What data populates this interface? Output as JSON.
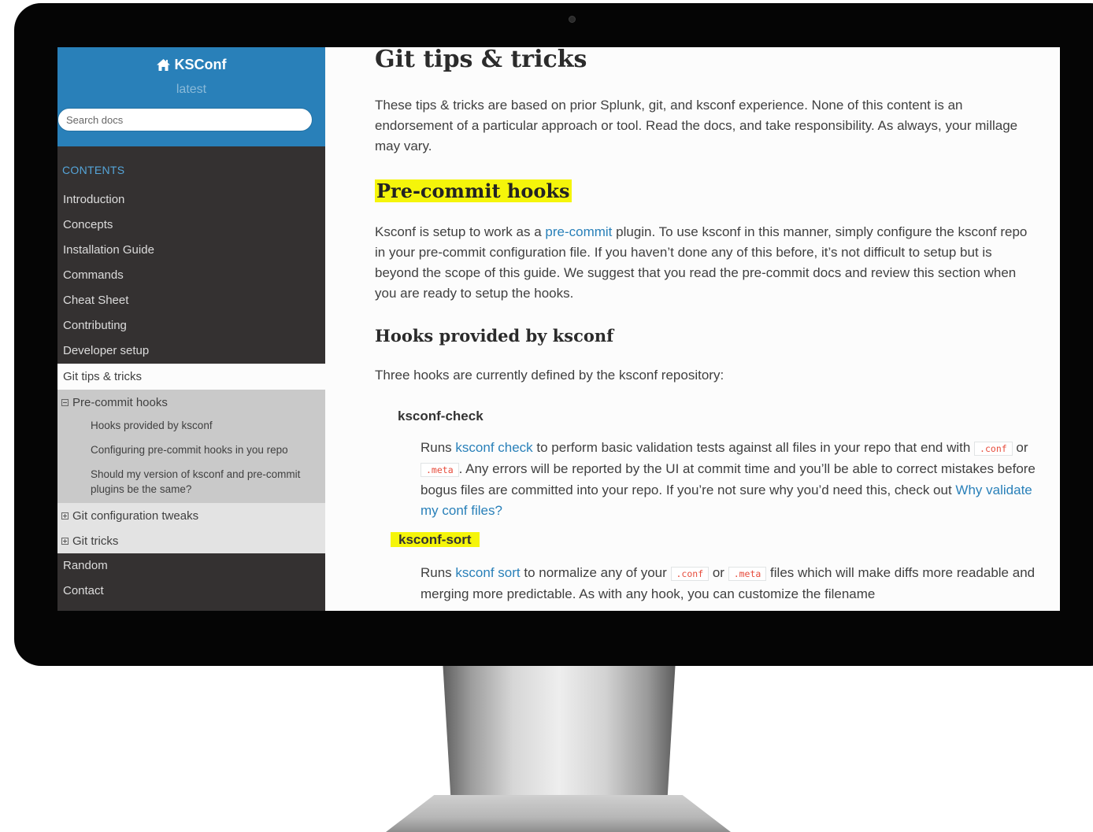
{
  "sidebar": {
    "brand": "KSConf",
    "version": "latest",
    "search_placeholder": "Search docs",
    "caption": "CONTENTS",
    "nav_top": [
      "Introduction",
      "Concepts",
      "Installation Guide",
      "Commands",
      "Cheat Sheet",
      "Contributing",
      "Developer setup"
    ],
    "current": "Git tips & tricks",
    "current_sub": "Pre-commit hooks",
    "sub_items": [
      "Hooks provided by ksconf",
      "Configuring pre-commit hooks in you repo",
      "Should my version of ksconf and pre-commit plugins be the same?"
    ],
    "other_subs": [
      "Git configuration tweaks",
      "Git tricks"
    ],
    "nav_bottom": [
      "Random",
      "Contact"
    ]
  },
  "content": {
    "title": "Git tips & tricks",
    "intro": "These tips & tricks are based on prior Splunk, git, and ksconf experience. None of this content is an endorsement of a particular approach or tool. Read the docs, and take responsibility. As always, your millage may vary.",
    "section_title": "Pre-commit hooks",
    "precommit": {
      "before": "Ksconf is setup to work as a ",
      "link": "pre-commit",
      "after": " plugin. To use ksconf in this manner, simply configure the ksconf repo in your pre-commit configuration file. If you haven’t done any of this before, it’s not difficult to setup but is beyond the scope of this guide. We suggest that you read the pre-commit docs and review this section when you are ready to setup the hooks."
    },
    "hooks_title": "Hooks provided by ksconf",
    "hooks_intro": "Three hooks are currently defined by the ksconf repository:",
    "check": {
      "term": "ksconf-check",
      "runs": "Runs ",
      "link": "ksconf check",
      "t1": " to perform basic validation tests against all files in your repo that end with ",
      "code1": ".conf",
      "or": " or ",
      "code2": ".meta",
      "t2": ". Any errors will be reported by the UI at commit time and you’ll be able to correct mistakes before bogus files are committed into your repo. If you’re not sure why you’d need this, check out ",
      "link2": "Why validate my conf files?"
    },
    "sort": {
      "term": "ksconf-sort",
      "runs": "Runs ",
      "link": "ksconf sort",
      "t1": " to normalize any of your ",
      "code1": ".conf",
      "or": " or ",
      "code2": ".meta",
      "t2": " files which will make diffs more readable and merging more predictable. As with any hook, you can customize the filename"
    }
  },
  "colors": {
    "sidebar_top": "#2980b9",
    "sidebar_bg": "#343131",
    "link": "#2980b9",
    "highlight": "#f5f50a"
  }
}
